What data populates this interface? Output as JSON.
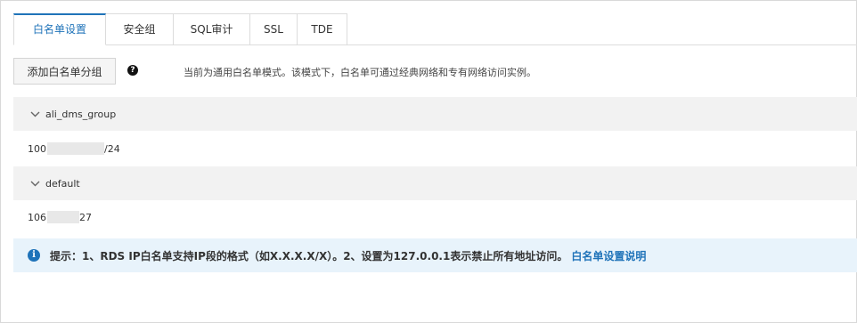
{
  "tabs": [
    {
      "label": "白名单设置",
      "active": true
    },
    {
      "label": "安全组",
      "active": false
    },
    {
      "label": "SQL审计",
      "active": false
    },
    {
      "label": "SSL",
      "active": false
    },
    {
      "label": "TDE",
      "active": false
    }
  ],
  "toolbar": {
    "add_group_label": "添加白名单分组",
    "help_icon": "question-circle-icon",
    "mode_hint": "当前为通用白名单模式。该模式下，白名单可通过经典网络和专有网络访问实例。"
  },
  "groups": [
    {
      "name": "ali_dms_group",
      "ip_prefix": "100",
      "ip_suffix": "/24"
    },
    {
      "name": "default",
      "ip_prefix": "106",
      "ip_suffix": "27"
    }
  ],
  "notice": {
    "icon": "info-circle-icon",
    "text": "提示：1、RDS IP白名单支持IP段的格式（如X.X.X.X/X）。2、设置为127.0.0.1表示禁止所有地址访问。",
    "link": "白名单设置说明"
  },
  "colors": {
    "accent": "#1f73b9",
    "group_bg": "#f2f2f2",
    "notice_bg": "#e8f3fb"
  }
}
